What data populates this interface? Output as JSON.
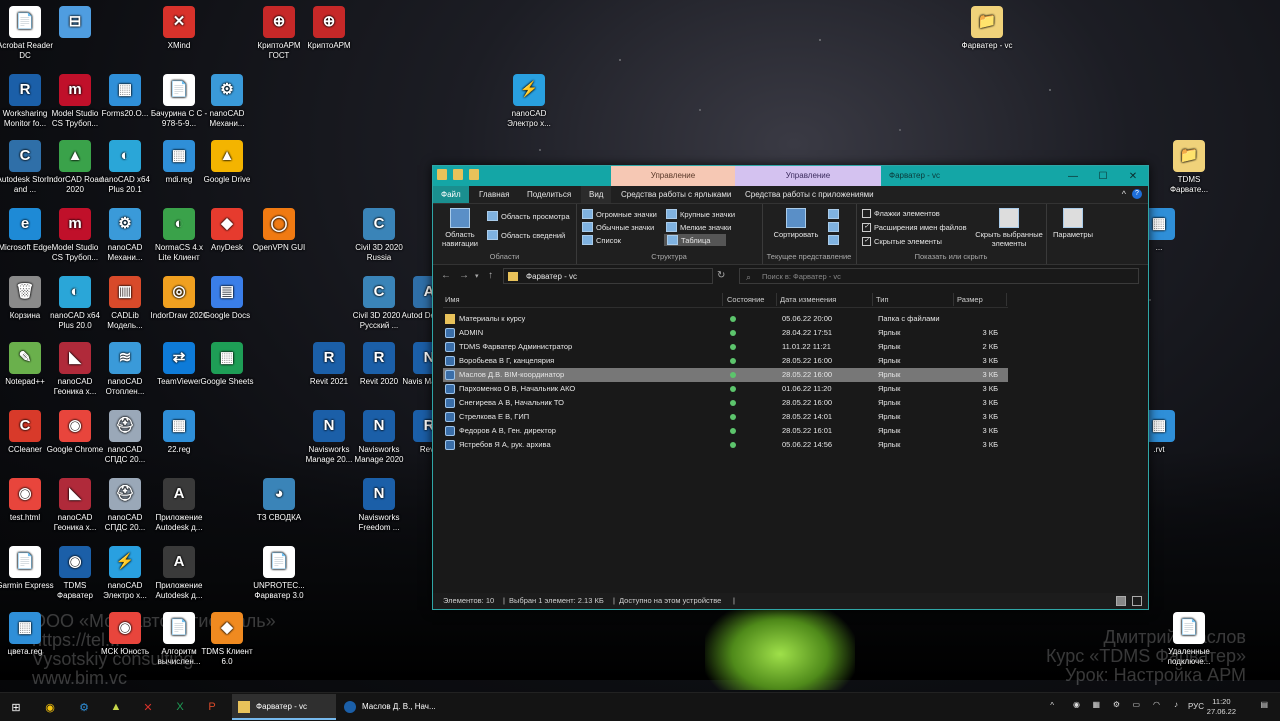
{
  "desktop": {
    "icons": [
      {
        "label": "Acrobat Reader DC",
        "glyph": "📄",
        "color": "#ffffff"
      },
      {
        "label": "",
        "glyph": "⊟",
        "color": "#4f9de0"
      },
      {
        "label": "XMind",
        "glyph": "✕",
        "color": "#d8322b"
      },
      {
        "label": "КриптоАРМ ГОСТ",
        "glyph": "⊕",
        "color": "#c62828"
      },
      {
        "label": "КриптоАРМ",
        "glyph": "⊕",
        "color": "#c62828"
      },
      {
        "label": "Фарватер - vc",
        "glyph": "📁",
        "color": "#f0d27a"
      },
      {
        "label": "Worksharing Monitor fo...",
        "glyph": "R",
        "color": "#1b5fa8"
      },
      {
        "label": "Model Studio CS Трубоп...",
        "glyph": "m",
        "color": "#c0102a"
      },
      {
        "label": "Forms20.O...",
        "glyph": "▦",
        "color": "#2f8fd8"
      },
      {
        "label": "Бачурина С С - 978-5-9...",
        "glyph": "📄",
        "color": "#ffffff"
      },
      {
        "label": "nanoCAD Механи...",
        "glyph": "⚙",
        "color": "#3a9ad9"
      },
      {
        "label": "nanoCAD Электро х...",
        "glyph": "⚡",
        "color": "#29a0e0"
      },
      {
        "label": "Autodesk Storm and ...",
        "glyph": "C",
        "color": "#2f6fa8"
      },
      {
        "label": "IndorCAD Road 2020",
        "glyph": "▲",
        "color": "#3aa24a"
      },
      {
        "label": "nanoCAD x64 Plus 20.1",
        "glyph": "◐",
        "color": "#2aa6d8"
      },
      {
        "label": "mdi.reg",
        "glyph": "▦",
        "color": "#2f8fd8"
      },
      {
        "label": "Google Drive",
        "glyph": "▲",
        "color": "#f4b400"
      },
      {
        "label": "TDMS Фарвате...",
        "glyph": "📁",
        "color": "#f0d27a"
      },
      {
        "label": "Microsoft Edge",
        "glyph": "e",
        "color": "#1e8ad6"
      },
      {
        "label": "Model Studio CS Трубоп...",
        "glyph": "m",
        "color": "#c0102a"
      },
      {
        "label": "nanoCAD Механи...",
        "glyph": "⚙",
        "color": "#3a9ad9"
      },
      {
        "label": "NormaCS 4.x Lite Клиент",
        "glyph": "◐",
        "color": "#3aa24a"
      },
      {
        "label": "AnyDesk",
        "glyph": "◆",
        "color": "#e63b2e"
      },
      {
        "label": "OpenVPN GUI",
        "glyph": "◯",
        "color": "#f07a12"
      },
      {
        "label": "Civil 3D 2020 Russia",
        "glyph": "C",
        "color": "#3a84b8"
      },
      {
        "label": "Корзина",
        "glyph": "🗑",
        "color": "#8a8a8a"
      },
      {
        "label": "nanoCAD x64 Plus 20.0",
        "glyph": "◐",
        "color": "#2aa6d8"
      },
      {
        "label": "CADLib Модель...",
        "glyph": "▥",
        "color": "#d84a2a"
      },
      {
        "label": "IndorDraw 2020",
        "glyph": "◎",
        "color": "#f0a020"
      },
      {
        "label": "Google Docs",
        "glyph": "▤",
        "color": "#3a7ee8"
      },
      {
        "label": "Civil 3D 2020 - Русский ...",
        "glyph": "C",
        "color": "#3a84b8"
      },
      {
        "label": "Autod Design...",
        "glyph": "A",
        "color": "#2f6fa8"
      },
      {
        "label": "Notepad++",
        "glyph": "✎",
        "color": "#6ab04c"
      },
      {
        "label": "nanoCAD Геоника х...",
        "glyph": "◣",
        "color": "#b02a3a"
      },
      {
        "label": "nanoCAD Отоплен...",
        "glyph": "≋",
        "color": "#3a9ad9"
      },
      {
        "label": "TeamViewer",
        "glyph": "⇄",
        "color": "#0e7bd8"
      },
      {
        "label": "Google Sheets",
        "glyph": "▦",
        "color": "#1e9e56"
      },
      {
        "label": "Revit 2021",
        "glyph": "R",
        "color": "#1b5fa8"
      },
      {
        "label": "Revit 2020",
        "glyph": "R",
        "color": "#1b5fa8"
      },
      {
        "label": "Navis Manag...",
        "glyph": "N",
        "color": "#1b5fa8"
      },
      {
        "label": "CCleaner",
        "glyph": "C",
        "color": "#d83a2a"
      },
      {
        "label": "Google Chrome",
        "glyph": "◉",
        "color": "#e8453c"
      },
      {
        "label": "nanoCAD СПДС 20...",
        "glyph": "⛑",
        "color": "#9aa8b8"
      },
      {
        "label": "22.reg",
        "glyph": "▦",
        "color": "#2f8fd8"
      },
      {
        "label": "Navisworks Manage 20...",
        "glyph": "N",
        "color": "#1b5fa8"
      },
      {
        "label": "Navisworks Manage 2020",
        "glyph": "N",
        "color": "#1b5fa8"
      },
      {
        "label": "Revit",
        "glyph": "R",
        "color": "#1b5fa8"
      },
      {
        "label": "test.html",
        "glyph": "◉",
        "color": "#e8453c"
      },
      {
        "label": "nanoCAD Геоника х...",
        "glyph": "◣",
        "color": "#b02a3a"
      },
      {
        "label": "nanoCAD СПДС 20...",
        "glyph": "⛑",
        "color": "#9aa8b8"
      },
      {
        "label": "Приложение Autodesk д...",
        "glyph": "A",
        "color": "#3a3a3a"
      },
      {
        "label": "ТЗ СВОДКА",
        "glyph": "◕",
        "color": "#3a84b8"
      },
      {
        "label": "Navisworks Freedom ...",
        "glyph": "N",
        "color": "#1b5fa8"
      },
      {
        "label": "Garmin Express",
        "glyph": "📄",
        "color": "#ffffff"
      },
      {
        "label": "TDMS Фарватер",
        "glyph": "◉",
        "color": "#1b5fa8"
      },
      {
        "label": "nanoCAD Электро х...",
        "glyph": "⚡",
        "color": "#29a0e0"
      },
      {
        "label": "Приложение Autodesk д...",
        "glyph": "A",
        "color": "#3a3a3a"
      },
      {
        "label": "UNPROTEC... Фарватер 3.0",
        "glyph": "📄",
        "color": "#ffffff"
      },
      {
        "label": "цвета.reg",
        "glyph": "▦",
        "color": "#2f8fd8"
      },
      {
        "label": "МСК Юность",
        "glyph": "◉",
        "color": "#e8453c"
      },
      {
        "label": "Алгоритм вычислен...",
        "glyph": "📄",
        "color": "#ffffff"
      },
      {
        "label": "TDMS Клиент 6.0",
        "glyph": "◆",
        "color": "#f08a20"
      },
      {
        "label": "Удаленные подключе...",
        "glyph": "📄",
        "color": "#ffffff"
      },
      {
        "label": ".rvt",
        "glyph": "▦",
        "color": "#2f8fd8"
      },
      {
        "label": "...",
        "glyph": "▦",
        "color": "#2f8fd8"
      }
    ],
    "watermark_left": [
      "ООО «Моссавтомагистраль»",
      "https://tel...",
      "Vysotskiy consulting",
      "www.bim.vc"
    ],
    "watermark_right": [
      "Дмитрий Маслов",
      "Курс «TDMS Фарватер»",
      "Урок: Настройка АРМ"
    ]
  },
  "explorer": {
    "ctx_tab1": "Управление",
    "ctx_tab2": "Управление",
    "title": "Фарватер - vc",
    "tabs": {
      "file": "Файл",
      "home": "Главная",
      "share": "Поделиться",
      "view": "Вид",
      "shortcut_tools": "Средства работы с ярлыками",
      "app_tools": "Средства работы с приложениями"
    },
    "ribbon": {
      "nav_pane": "Область навигации",
      "preview_pane": "Область просмотра",
      "details_pane": "Область сведений",
      "areas": "Области",
      "huge_icons": "Огромные значки",
      "large_icons": "Крупные значки",
      "normal_icons": "Обычные значки",
      "small_icons": "Мелкие значки",
      "list": "Список",
      "table": "Таблица",
      "structure": "Структура",
      "sort": "Сортировать",
      "current_view": "Текущее представление",
      "item_checkboxes": "Флажки элементов",
      "file_ext": "Расширения имен файлов",
      "hidden_items": "Скрытые элементы",
      "hide_selected": "Скрыть выбранные элементы",
      "show_hide": "Показать или скрыть",
      "options": "Параметры"
    },
    "address": {
      "path": "Фарватер - vc",
      "search_placeholder": "Поиск в: Фарватер - vc"
    },
    "columns": {
      "name": "Имя",
      "state": "Состояние",
      "date": "Дата изменения",
      "type": "Тип",
      "size": "Размер"
    },
    "rows": [
      {
        "name": "Материалы к курсу",
        "date": "05.06.22 20:00",
        "type": "Папка с файлами",
        "size": "",
        "kind": "folder"
      },
      {
        "name": "ADMIN",
        "date": "28.04.22 17:51",
        "type": "Ярлык",
        "size": "3 КБ",
        "kind": "lnk"
      },
      {
        "name": "TDMS Фарватер Администратор",
        "date": "11.01.22 11:21",
        "type": "Ярлык",
        "size": "2 КБ",
        "kind": "lnk"
      },
      {
        "name": "Воробьева В Г, канцелярия",
        "date": "28.05.22 16:00",
        "type": "Ярлык",
        "size": "3 КБ",
        "kind": "lnk"
      },
      {
        "name": "Маслов Д.В. BIM-координатор",
        "date": "28.05.22 16:00",
        "type": "Ярлык",
        "size": "3 КБ",
        "kind": "lnk",
        "selected": true
      },
      {
        "name": "Пархоменко О В, Начальник АКО",
        "date": "01.06.22 11:20",
        "type": "Ярлык",
        "size": "3 КБ",
        "kind": "lnk"
      },
      {
        "name": "Снегирева А В, Начальник ТО",
        "date": "28.05.22 16:00",
        "type": "Ярлык",
        "size": "3 КБ",
        "kind": "lnk"
      },
      {
        "name": "Стрелкова Е В, ГИП",
        "date": "28.05.22 14:01",
        "type": "Ярлык",
        "size": "3 КБ",
        "kind": "lnk"
      },
      {
        "name": "Федоров А В, Ген. директор",
        "date": "28.05.22 16:01",
        "type": "Ярлык",
        "size": "3 КБ",
        "kind": "lnk"
      },
      {
        "name": "Ястребов Я А, рук. архива",
        "date": "05.06.22 14:56",
        "type": "Ярлык",
        "size": "3 КБ",
        "kind": "lnk"
      }
    ],
    "status": {
      "count": "Элементов: 10",
      "selected": "Выбран 1 элемент: 2.13 КБ",
      "avail": "Доступно на этом устройстве"
    }
  },
  "taskbar": {
    "app1": "Фарватер - vc",
    "app2": "Маслов Д. В., Нач...",
    "lang": "РУС",
    "time": "11:20",
    "date": "27.06.22"
  }
}
